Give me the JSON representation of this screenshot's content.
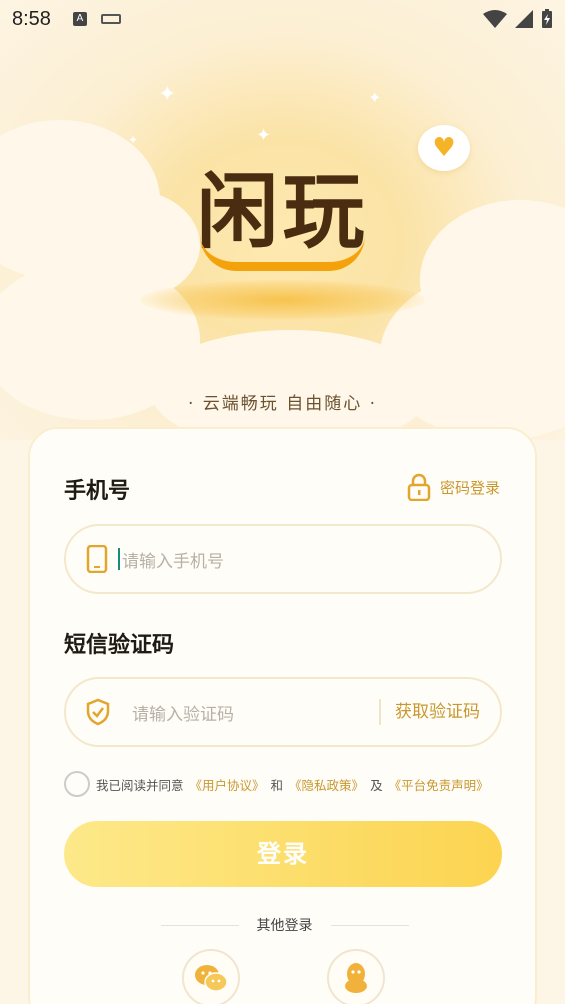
{
  "status": {
    "time": "8:58"
  },
  "brand": {
    "logo": "闲玩",
    "slogan": "· 云端畅玩 自由随心 ·"
  },
  "form": {
    "phone_label": "手机号",
    "password_login": "密码登录",
    "phone_placeholder": "请输入手机号",
    "sms_label": "短信验证码",
    "code_placeholder": "请输入验证码",
    "get_code": "获取验证码",
    "agree_prefix": "我已阅读并同意",
    "user_agreement": "《用户协议》",
    "and1": "和",
    "privacy": "《隐私政策》",
    "and2": "及",
    "disclaimer": "《平台免责声明》",
    "login_button": "登录",
    "other_login": "其他登录"
  },
  "icons": {
    "phone": "phone-icon",
    "shield": "shield-check-icon",
    "lock": "lock-icon",
    "wechat": "wechat-icon",
    "qq": "qq-icon",
    "heart": "heart-bubble-icon"
  },
  "colors": {
    "accent": "#c9972f",
    "button": "#fcd450",
    "logo": "#4a2d10",
    "smile": "#f4a20c"
  }
}
